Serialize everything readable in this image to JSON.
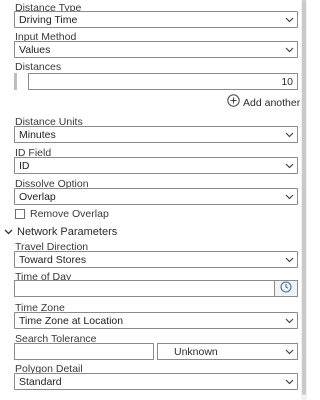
{
  "distance_type": {
    "label": "Distance Type",
    "value": "Driving Time"
  },
  "input_method": {
    "label": "Input Method",
    "value": "Values"
  },
  "distances": {
    "label": "Distances",
    "value": "10",
    "add_label": "Add another"
  },
  "distance_units": {
    "label": "Distance Units",
    "value": "Minutes"
  },
  "id_field": {
    "label": "ID Field",
    "value": "ID"
  },
  "dissolve_option": {
    "label": "Dissolve Option",
    "value": "Overlap"
  },
  "remove_overlap": {
    "label": "Remove Overlap",
    "checked": false
  },
  "network_parameters": {
    "title": "Network Parameters",
    "expanded": true
  },
  "travel_direction": {
    "label": "Travel Direction",
    "value": "Toward Stores"
  },
  "time_of_day": {
    "label": "Time of Day",
    "value": ""
  },
  "time_zone": {
    "label": "Time Zone",
    "value": "Time Zone at Location"
  },
  "search_tolerance": {
    "label": "Search Tolerance",
    "value": "",
    "units": "Unknown"
  },
  "polygon_detail": {
    "label": "Polygon Detail",
    "value": "Standard"
  },
  "icons": {
    "dropdown": "chevron-down-icon",
    "add": "plus-circle-icon",
    "section": "chevron-down-icon",
    "clock": "clock-icon"
  },
  "colors": {
    "border": "#8a8a8a",
    "text": "#2b2b2b",
    "clock_accent": "#3c6fa8"
  }
}
